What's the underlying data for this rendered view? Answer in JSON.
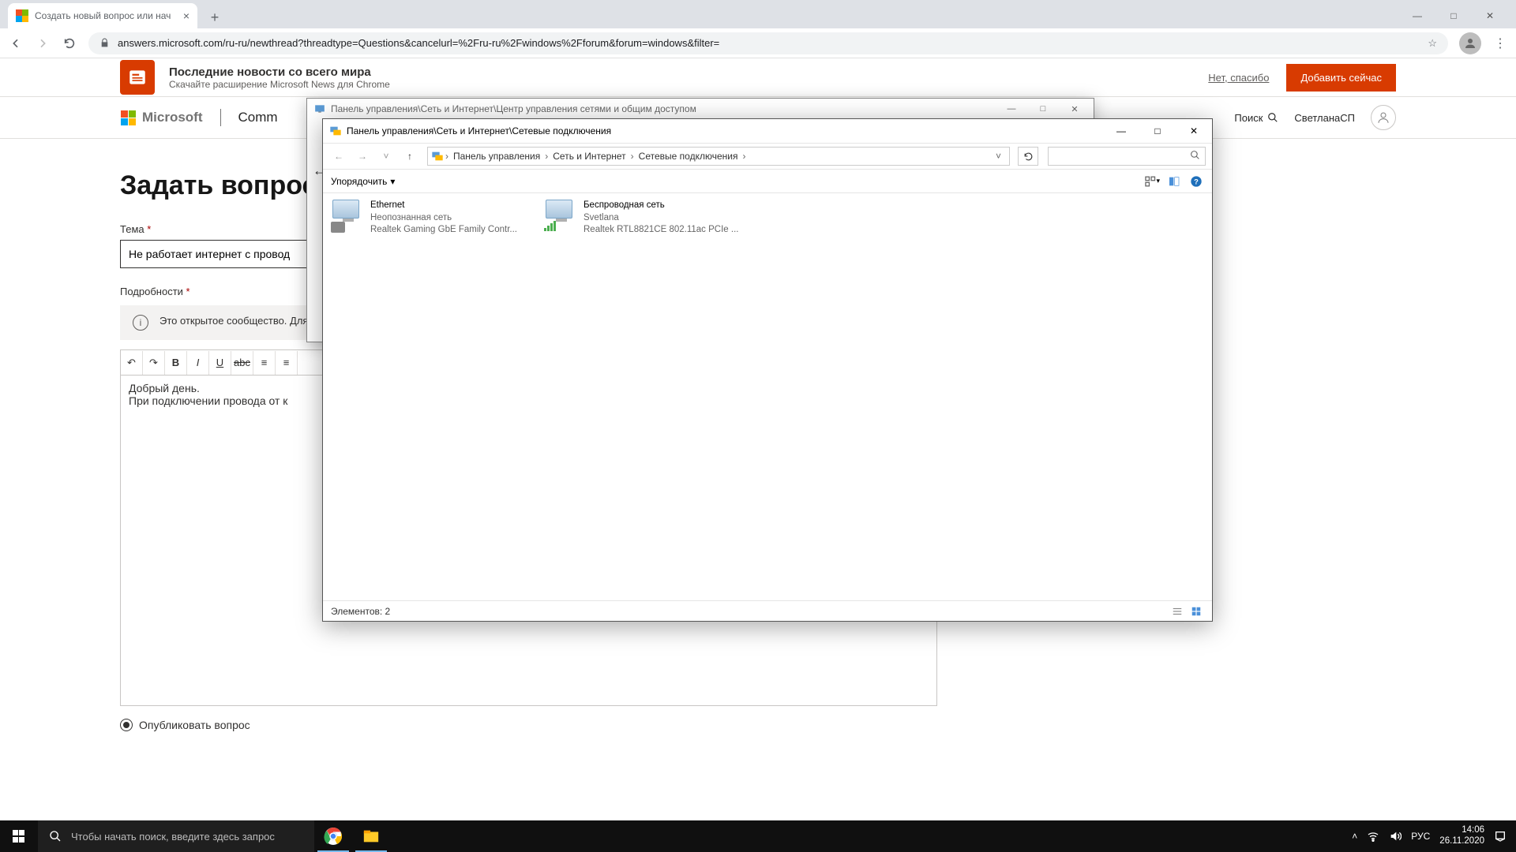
{
  "browser": {
    "tab_title": "Создать новый вопрос или нач",
    "url": "answers.microsoft.com/ru-ru/newthread?threadtype=Questions&cancelurl=%2Fru-ru%2Fwindows%2Fforum&forum=windows&filter=",
    "win_min": "—",
    "win_max": "□",
    "win_close": "✕"
  },
  "news_banner": {
    "title": "Последние новости со всего мира",
    "subtitle": "Скачайте расширение Microsoft News для Chrome",
    "no": "Нет, спасибо",
    "add": "Добавить сейчас"
  },
  "header": {
    "ms": "Microsoft",
    "community": "Comm",
    "search": "Поиск",
    "username": "СветланаСП"
  },
  "page": {
    "title": "Задать вопрос",
    "theme_label": "Тема",
    "theme_value": "Не работает интернет с провод",
    "details_label": "Подробности",
    "note": "Это открытое сообщество. Для защиты вашей конфиденциальности не разглашайте личную информацию, такую как ключ продукта, пароль или номер",
    "editor_text": "Добрый день.\nПри подключении провода от к",
    "publish": "Опубликовать вопрос"
  },
  "bg_window": {
    "title": "Панель управления\\Сеть и Интернет\\Центр управления сетями и общим доступом"
  },
  "explorer": {
    "title": "Панель управления\\Сеть и Интернет\\Сетевые подключения",
    "crumbs": [
      "Панель управления",
      "Сеть и Интернет",
      "Сетевые подключения"
    ],
    "organize": "Упорядочить",
    "connections": [
      {
        "name": "Ethernet",
        "status": "Неопознанная сеть",
        "device": "Realtek Gaming GbE Family Contr...",
        "type": "wired"
      },
      {
        "name": "Беспроводная сеть",
        "status": "Svetlana",
        "device": "Realtek RTL8821CE 802.11ac PCIe ...",
        "type": "wifi"
      }
    ],
    "status": "Элементов: 2"
  },
  "taskbar": {
    "search_placeholder": "Чтобы начать поиск, введите здесь запрос",
    "lang": "РУС",
    "time": "14:06",
    "date": "26.11.2020"
  }
}
